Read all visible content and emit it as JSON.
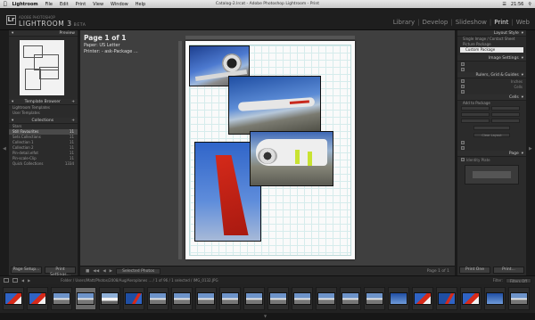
{
  "menubar": {
    "app": "Lightroom",
    "items": [
      "File",
      "Edit",
      "Print",
      "View",
      "Window",
      "Help"
    ],
    "window_title": "Catalog-2.lrcat - Adobe Photoshop Lightroom - Print",
    "clock": "21:56"
  },
  "identity": {
    "small": "ADOBE PHOTOSHOP",
    "name": "LIGHTROOM 3",
    "version": "BETA",
    "modules": [
      "Library",
      "Develop",
      "Slideshow",
      "Print",
      "Web"
    ],
    "active_module": "Print"
  },
  "left_panel": {
    "preview_title": "Preview",
    "template_title": "Template Browser",
    "templates": [
      "Lightroom Templates",
      "User Templates"
    ],
    "collections_title": "Collections",
    "collections": [
      {
        "label": "Stars",
        "count": ""
      },
      {
        "label": "Still Favourites",
        "count": "11"
      },
      {
        "label": "Sets Collections",
        "count": "11"
      },
      {
        "label": "Collection 1",
        "count": "11"
      },
      {
        "label": "Collection 2",
        "count": "11"
      },
      {
        "label": "Pin-detail.elfot",
        "count": "11"
      },
      {
        "label": "Pin-scale-Clip",
        "count": "11"
      },
      {
        "label": "Quick Collections",
        "count": "1334"
      }
    ],
    "btn_page_setup": "Page Setup...",
    "btn_print_settings": "Print Settings..."
  },
  "center": {
    "page_title": "Page 1 of 1",
    "paper_line": "Paper: US Letter",
    "printer_line": "Printer: - ask-Package ...",
    "toolbar_dropdown": "Selected Photos",
    "page_count": "Page 1 of 1"
  },
  "right_panel": {
    "layout_style_title": "Layout Style",
    "layout_styles": [
      "Single Image / Contact Sheet",
      "Picture Package",
      "Custom Package"
    ],
    "selected_style": "Custom Package",
    "image_settings_title": "Image Settings",
    "rulers_title": "Rulers, Grid & Guides",
    "rulers_units": "Inches",
    "grid_snap": "Cells",
    "cells_title": "Cells",
    "add_to_package": "Add to Package",
    "clear_layout": "Clear Layout",
    "page_title": "Page",
    "photo_info": "Identity Plate",
    "btn_print_one": "Print One",
    "btn_print": "Print..."
  },
  "filmstrip": {
    "path": "Folder / Users/Matt/Photos/2008/Aug/Aeroplanes ... / 1 of 96 / 1 selected / IMG_0132.JPG",
    "filter_label": "Filter:",
    "filter_value": "Filters Off",
    "thumbs": [
      "red-tail",
      "red-tail",
      "jet",
      "jet",
      "plane-white",
      "tail-blue",
      "jet",
      "jet",
      "jet",
      "jet",
      "jet",
      "jet",
      "jet",
      "jet",
      "jet",
      "jet",
      "blue-sky",
      "red-tail",
      "tail-blue",
      "red-tail",
      "blue-sky",
      "jet"
    ]
  },
  "colors": {
    "accent": "#e6e6e6",
    "panel": "#2b2b2b",
    "tail_red": "#d62a1a"
  }
}
